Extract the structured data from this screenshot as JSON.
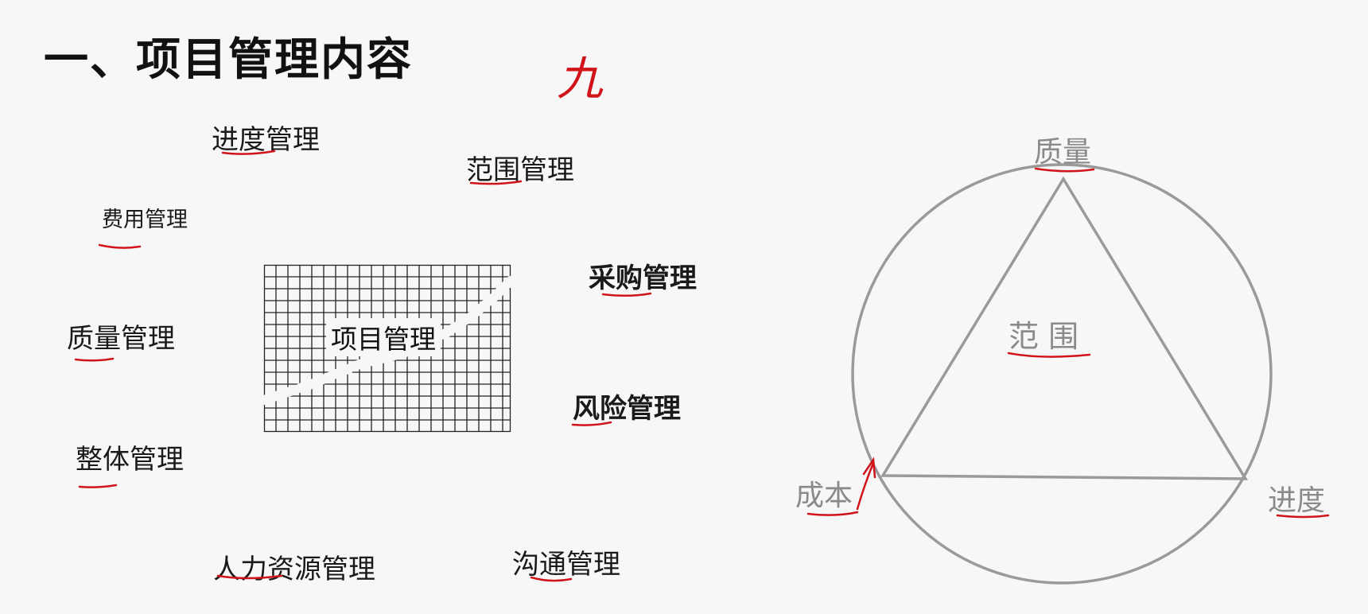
{
  "slide": {
    "title": "一、项目管理内容",
    "handwritten_note": "九"
  },
  "left_diagram": {
    "center": "项目管理",
    "areas": [
      "进度管理",
      "范围管理",
      "费用管理",
      "采购管理",
      "质量管理",
      "风险管理",
      "整体管理",
      "人力资源管理",
      "沟通管理"
    ]
  },
  "right_diagram": {
    "center": "范 围",
    "top": "质量",
    "left": "成本",
    "right": "进度"
  },
  "colors": {
    "annotation": "#d0141a",
    "diagram_line": "#9a9a9a",
    "grid_line": "#222222"
  }
}
